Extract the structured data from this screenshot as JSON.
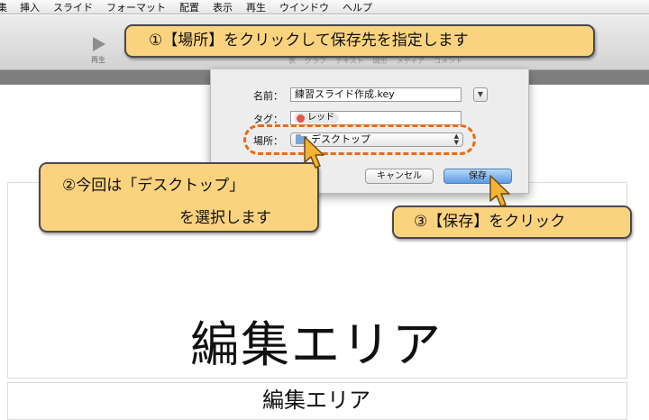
{
  "menubar": {
    "items": [
      "集",
      "挿入",
      "スライド",
      "フォーマット",
      "配置",
      "表示",
      "再生",
      "ウインドウ",
      "ヘルプ"
    ]
  },
  "toolbar": {
    "play_label": "再生",
    "labels": [
      "表",
      "グラフ",
      "テキスト",
      "図形",
      "メディア",
      "コメント"
    ]
  },
  "dialog": {
    "name_label": "名前：",
    "name_value": "練習スライド作成.key",
    "tag_label": "タグ：",
    "tag_value": "レッド",
    "location_label": "場所：",
    "location_value": "デスクトップ",
    "cancel_label": "キャンセル",
    "save_label": "保存"
  },
  "slide": {
    "main_text": "編集エリア",
    "thumb_text": "編集エリア"
  },
  "callouts": {
    "step1": "①【場所】をクリックして保存先を指定します",
    "step2_line1": "②今回は「デスクトップ」",
    "step2_line2": "を選択します",
    "step3": "③【保存】をクリック"
  },
  "colors": {
    "callout_fill": "#fbd37f",
    "dashed_highlight": "#ec6b12",
    "save_button": "#5b9be2",
    "tag_red": "#e2574c"
  }
}
